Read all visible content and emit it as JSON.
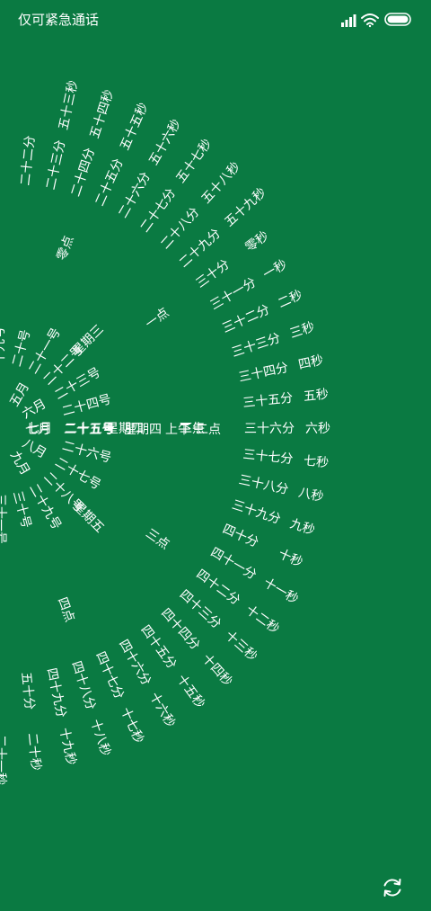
{
  "status": {
    "carrier": "仅可紧急通话"
  },
  "clock": {
    "center": {
      "month": "七月",
      "day": "二十五号",
      "weekday": "星期四",
      "period": "上午",
      "hour": "二点"
    },
    "months": {
      "items": [
        "五月",
        "六月",
        "七月",
        "八月",
        "九月"
      ]
    },
    "days": {
      "items": [
        "十九号",
        "二十号",
        "二十一号",
        "二十二号",
        "二十三号",
        "二十四号",
        "二十五号",
        "二十六号",
        "二十七号",
        "二十八号",
        "二十九号",
        "三十号",
        "三十一号"
      ]
    },
    "weekdays": {
      "items": [
        "星期三",
        "星期四",
        "星期五"
      ]
    },
    "periods": {
      "items": [
        "下午"
      ]
    },
    "hours": {
      "items": [
        "零点",
        "一点",
        "二点",
        "三点",
        "四点"
      ]
    },
    "minutes": {
      "items": [
        "二十二分",
        "二十三分",
        "二十四分",
        "二十五分",
        "二十六分",
        "二十七分",
        "二十八分",
        "二十九分",
        "三十分",
        "三十一分",
        "三十二分",
        "三十三分",
        "三十四分",
        "三十五分",
        "三十六分",
        "三十七分",
        "三十八分",
        "三十九分",
        "四十分",
        "四十一分",
        "四十二分",
        "四十三分",
        "四十四分",
        "四十五分",
        "四十六分",
        "四十七分",
        "四十八分",
        "四十九分",
        "五十分"
      ]
    },
    "seconds": {
      "items": [
        "五十三秒",
        "五十四秒",
        "五十五秒",
        "五十六秒",
        "五十七秒",
        "五十八秒",
        "五十九秒",
        "零秒",
        "一秒",
        "二秒",
        "三秒",
        "四秒",
        "五秒",
        "六秒",
        "七秒",
        "八秒",
        "九秒",
        "十秒",
        "十一秒",
        "十二秒",
        "十三秒",
        "十四秒",
        "十五秒",
        "十六秒",
        "十七秒",
        "十八秒",
        "十九秒",
        "二十秒",
        "二十一秒"
      ]
    }
  },
  "icons": {
    "signal": "signal-icon",
    "wifi": "wifi-icon",
    "battery": "battery-icon",
    "refresh": "refresh-icon"
  },
  "colors": {
    "background": "#0a7a42",
    "text": "#ffffff"
  }
}
